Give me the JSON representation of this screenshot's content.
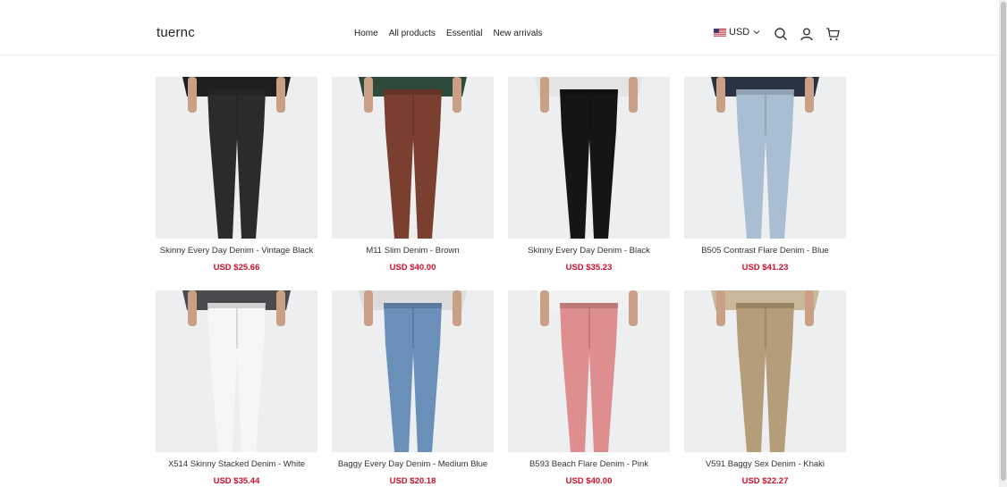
{
  "header": {
    "logo": "tuernc",
    "nav": [
      "Home",
      "All products",
      "Essential",
      "New arrivals"
    ],
    "currency": "USD",
    "icons": [
      "us-flag-icon",
      "chevron-down-icon",
      "search-icon",
      "account-icon",
      "cart-icon"
    ]
  },
  "products": [
    {
      "name": "Skinny Every Day Denim - Vintage Black",
      "price": "USD $25.66",
      "colors": {
        "top": "#1e1f21",
        "jeans": "#2b2b2d"
      }
    },
    {
      "name": "M11 Slim Denim - Brown",
      "price": "USD $40.00",
      "colors": {
        "top": "#2e4a3a",
        "jeans": "#7a3f2f"
      }
    },
    {
      "name": "Skinny Every Day Denim - Black",
      "price": "USD $35.23",
      "colors": {
        "top": "#e4e4e4",
        "jeans": "#151515"
      }
    },
    {
      "name": "B505 Contrast Flare Denim - Blue",
      "price": "USD $41.23",
      "colors": {
        "top": "#2a3340",
        "jeans": "#a9bed3"
      }
    },
    {
      "name": "X514 Skinny Stacked Denim - White",
      "price": "USD $35.44",
      "colors": {
        "top": "#4a4a4e",
        "jeans": "#f6f6f6"
      }
    },
    {
      "name": "Baggy Every Day Denim - Medium Blue",
      "price": "USD $20.18",
      "colors": {
        "top": "#dcdcdc",
        "jeans": "#6a8fb8"
      }
    },
    {
      "name": "B593 Beach Flare Denim - Pink",
      "price": "USD $40.00",
      "colors": {
        "top": "#f2f2f2",
        "jeans": "#de8e8e"
      }
    },
    {
      "name": "V591 Baggy Sex Denim - Khaki",
      "price": "USD $22.27",
      "colors": {
        "top": "#c9b79a",
        "jeans": "#b49d78"
      }
    }
  ],
  "accent_color": "#c8102e"
}
